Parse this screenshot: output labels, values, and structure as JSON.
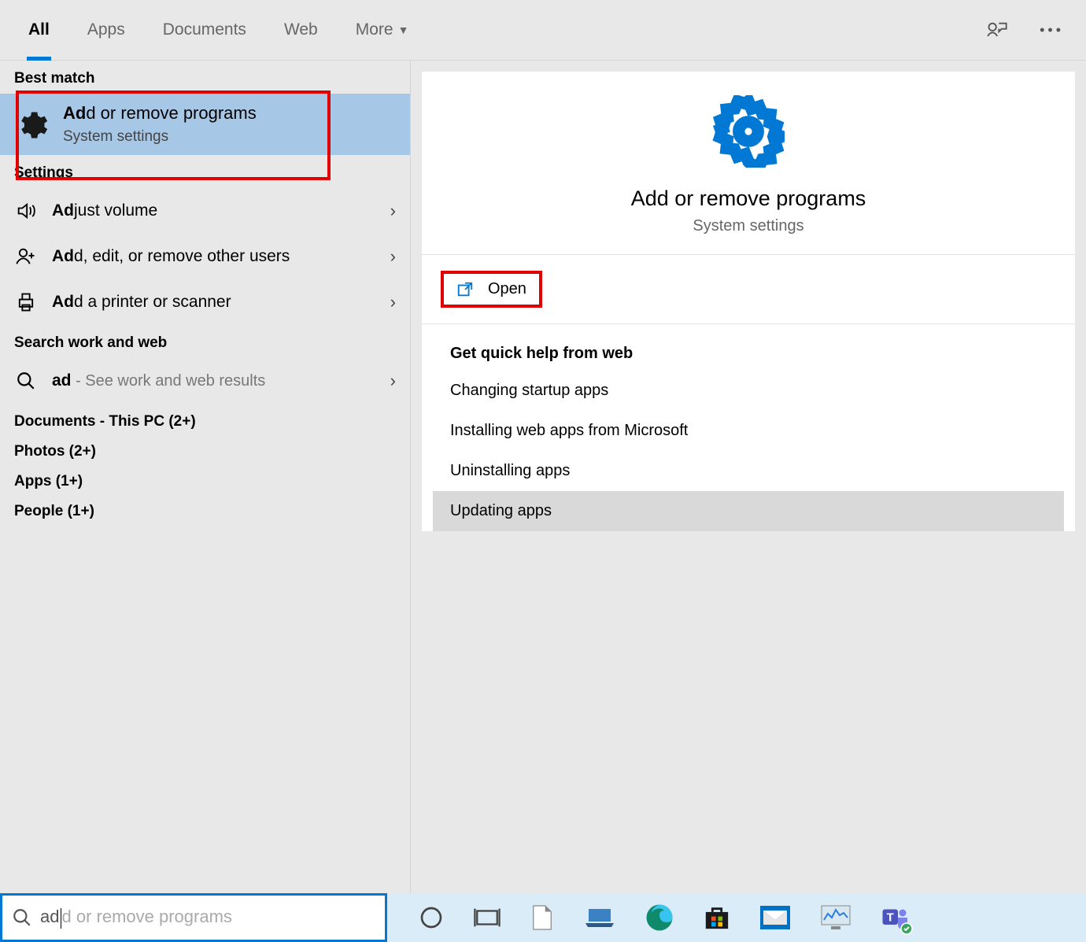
{
  "tabs": [
    "All",
    "Apps",
    "Documents",
    "Web",
    "More"
  ],
  "active_tab": "All",
  "left": {
    "best_match_label": "Best match",
    "best_match": {
      "title_bold": "Ad",
      "title_rest": "d or remove programs",
      "subtitle": "System settings"
    },
    "settings_label": "Settings",
    "settings": [
      {
        "bold": "Ad",
        "rest": "just volume",
        "icon": "speaker"
      },
      {
        "bold": "Ad",
        "rest": "d, edit, or remove other users",
        "icon": "user-plus"
      },
      {
        "bold": "Ad",
        "rest": "d a printer or scanner",
        "icon": "printer"
      }
    ],
    "search_web_label": "Search work and web",
    "web": {
      "query": "ad",
      "hint": " - See work and web results"
    },
    "groups": [
      "Documents - This PC (2+)",
      "Photos (2+)",
      "Apps (1+)",
      "People (1+)"
    ]
  },
  "right": {
    "title": "Add or remove programs",
    "subtitle": "System settings",
    "open_label": "Open",
    "help_title": "Get quick help from web",
    "help_links": [
      "Changing startup apps",
      "Installing web apps from Microsoft",
      "Uninstalling apps",
      "Updating apps"
    ]
  },
  "searchbar": {
    "typed": "ad",
    "ghost": "d or remove programs"
  }
}
